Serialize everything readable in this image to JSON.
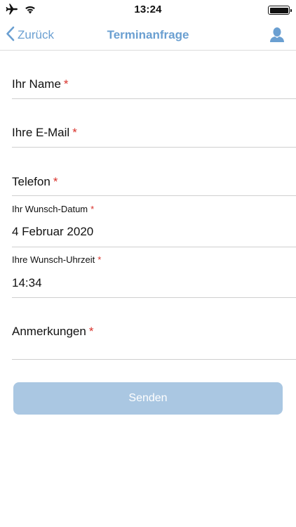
{
  "status_bar": {
    "time": "13:24",
    "icons": [
      "airplane-icon",
      "wifi-icon",
      "battery-icon"
    ],
    "battery_level": 1.0
  },
  "nav": {
    "back_label": "Zurück",
    "title": "Terminanfrage",
    "right_icon": "user-icon",
    "accent_color": "#6a9fd1"
  },
  "form": {
    "required_mark": "*",
    "name_label": "Ihr Name",
    "email_label": "Ihre E-Mail",
    "phone_label": "Telefon",
    "date_label": "Ihr Wunsch-Datum",
    "date_value": "4 Februar 2020",
    "time_label": "Ihre Wunsch-Uhrzeit",
    "time_value": "14:34",
    "notes_label": "Anmerkungen",
    "required_color": "#d9322b"
  },
  "submit": {
    "label": "Senden",
    "color": "#aac7e2"
  }
}
